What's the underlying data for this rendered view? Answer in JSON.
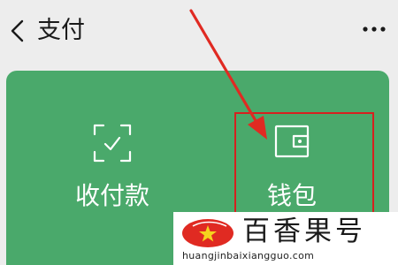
{
  "header": {
    "back_icon": "chevron-left-icon",
    "title": "支付",
    "more_icon": "more-dots-icon"
  },
  "actions": [
    {
      "icon": "scan-check-icon",
      "label": "收付款"
    },
    {
      "icon": "wallet-icon",
      "label": "钱包"
    }
  ],
  "watermark": {
    "title": "百香果号",
    "url": "huangjinbaixiangguo.com",
    "logo_icon": "star-logo-icon"
  },
  "colors": {
    "background": "#ededed",
    "panel": "#4aa96b",
    "highlight": "#d6201f",
    "logo_red": "#e02a22"
  }
}
